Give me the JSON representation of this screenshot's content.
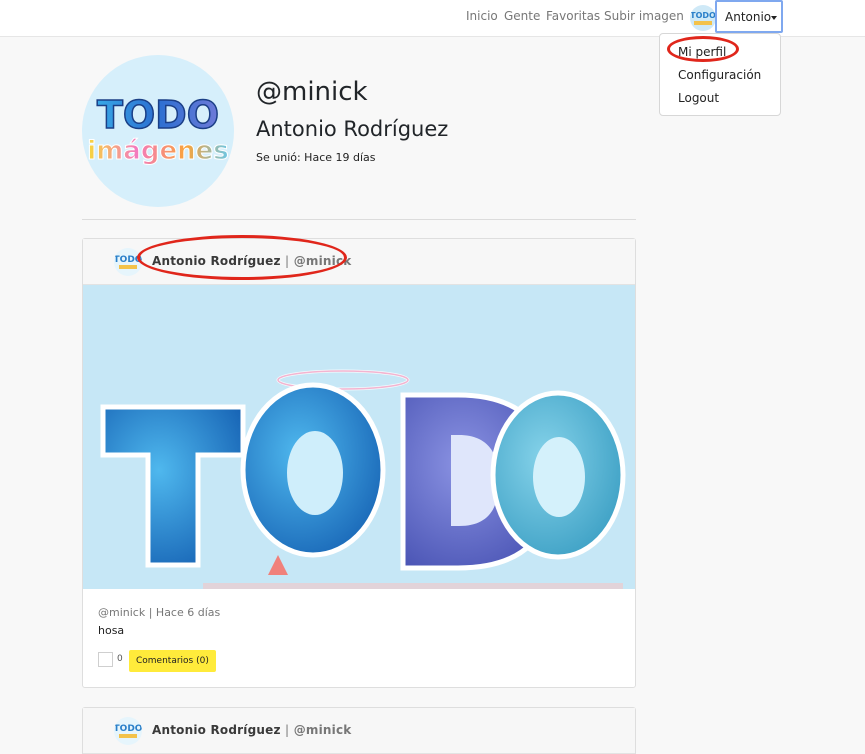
{
  "navbar": {
    "links": [
      "Inicio",
      "Gente",
      "Favoritas",
      "Subir imagen"
    ],
    "user_label": "Antonio"
  },
  "dropdown": {
    "items": [
      "Mi perfil",
      "Configuración",
      "Logout"
    ]
  },
  "profile": {
    "nick": "@minick",
    "name": "Antonio Rodríguez",
    "joined": "Se unió: Hace 19 días",
    "logo_line1": "TODO",
    "logo_line2": "imágenes"
  },
  "posts": [
    {
      "author": "Antonio Rodríguez",
      "separator": "|",
      "nick": "@minick",
      "meta": "@minick | Hace 6 días",
      "description": "hosa",
      "likes": "0",
      "comments_label": "Comentarios (0)",
      "image_text": "TODO"
    },
    {
      "author": "Antonio Rodríguez",
      "separator": "|",
      "nick": "@minick"
    }
  ],
  "colors": {
    "accent_yellow": "#ffeb3b",
    "annotation_red": "#e0261b",
    "focus_blue": "#7fa8ef"
  }
}
